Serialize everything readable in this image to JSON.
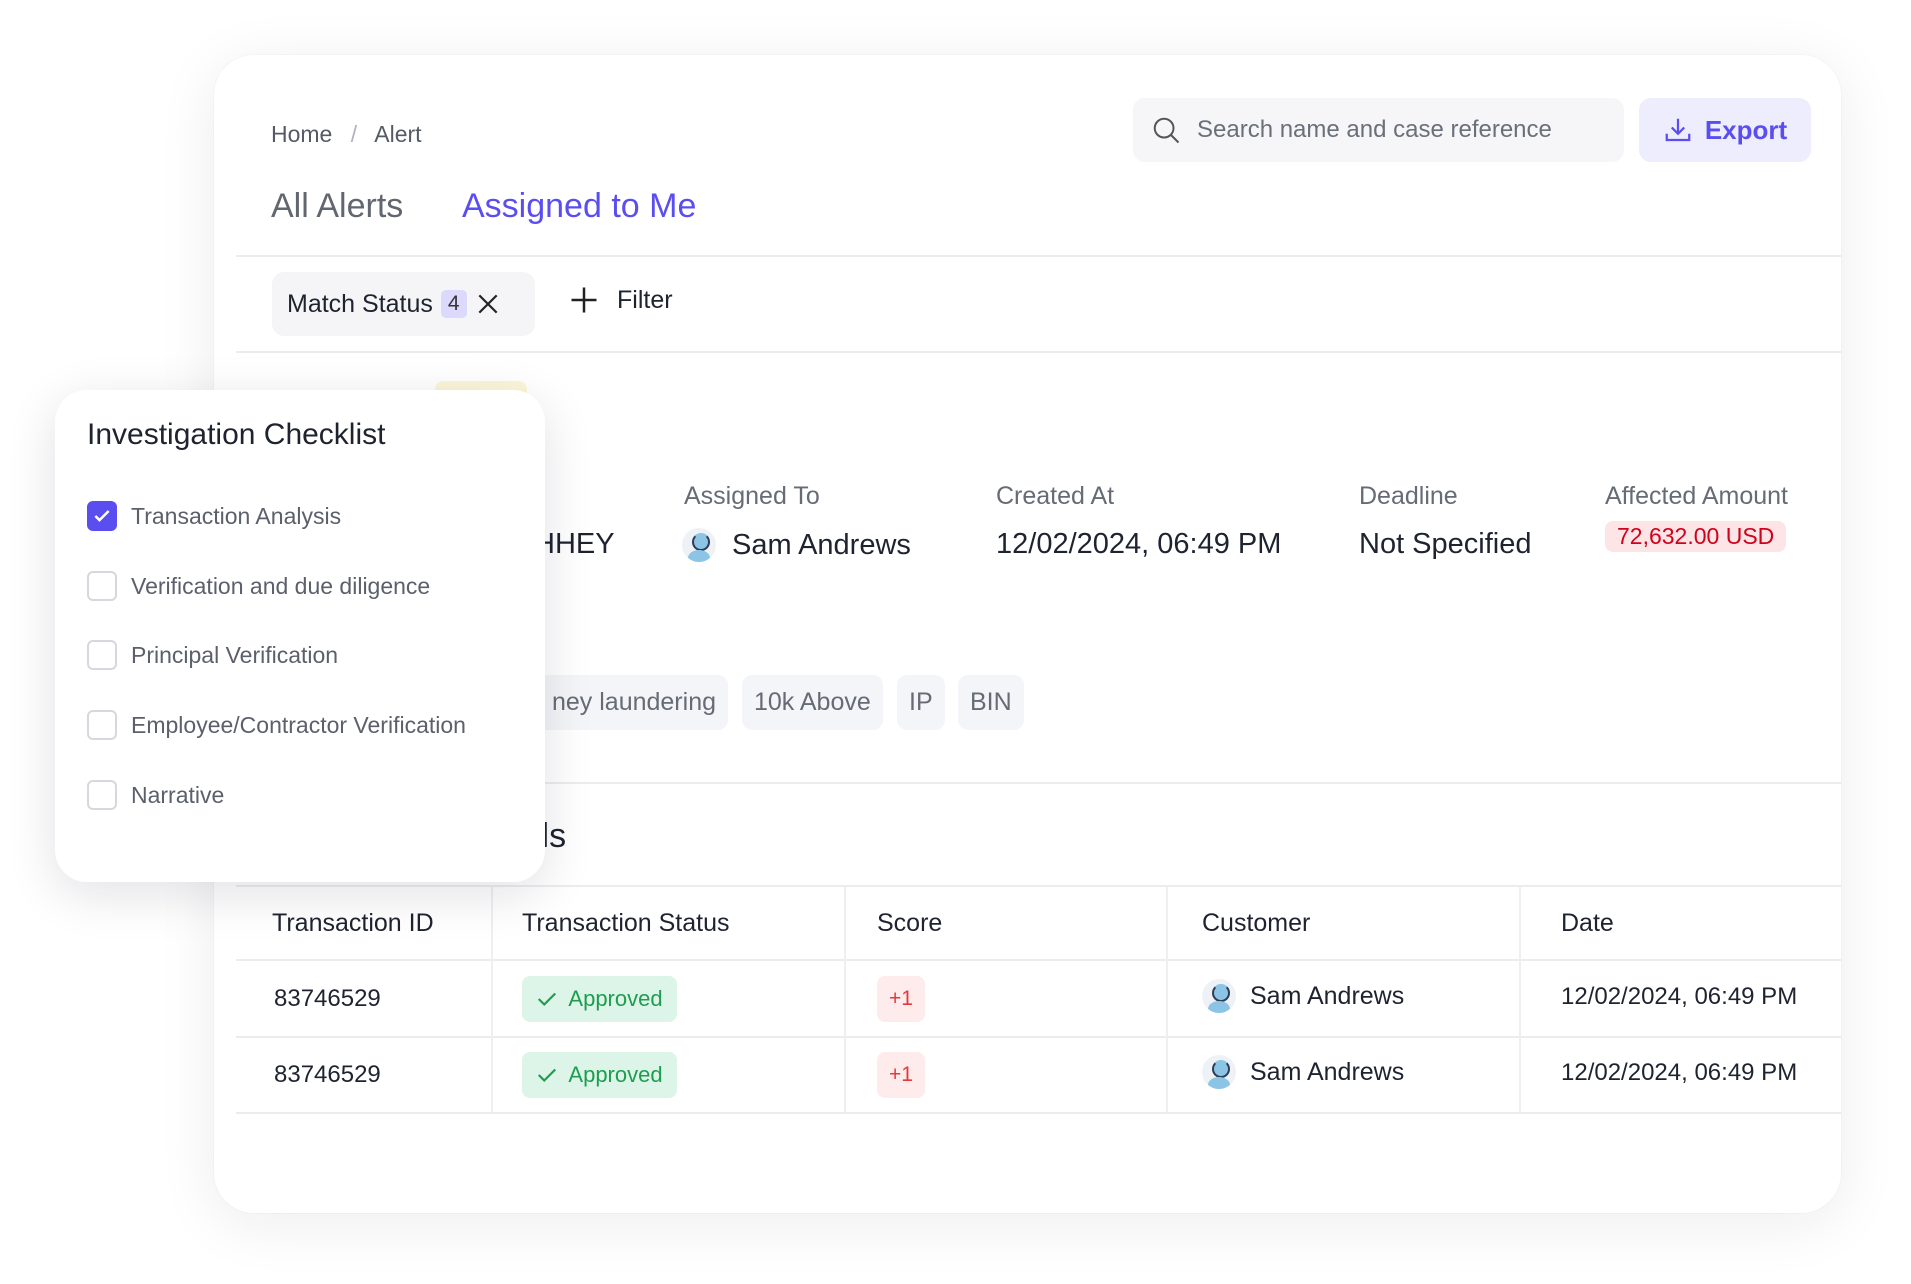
{
  "breadcrumb": {
    "items": [
      "Home",
      "Alert"
    ],
    "separator": "/"
  },
  "search": {
    "placeholder": "Search name and case reference",
    "icon": "search-icon"
  },
  "export": {
    "label": "Export",
    "icon": "download-icon"
  },
  "tabs": [
    {
      "label": "All Alerts",
      "active": false
    },
    {
      "label": "Assigned to Me",
      "active": true
    }
  ],
  "filters": {
    "chip_label": "Match Status",
    "chip_count": "4",
    "add_label": "Filter"
  },
  "alert": {
    "name_fragment": "HHEY",
    "assigned_to": {
      "label": "Assigned To",
      "value": "Sam Andrews"
    },
    "created_at": {
      "label": "Created At",
      "value": "12/02/2024, 06:49 PM"
    },
    "deadline": {
      "label": "Deadline",
      "value": "Not Specified"
    },
    "affected_amount": {
      "label": "Affected Amount",
      "value": "72,632.00 USD"
    },
    "tags": [
      "ney laundering",
      "10k Above",
      "IP",
      "BIN"
    ]
  },
  "section_heading_fragment": "ils",
  "table": {
    "columns": [
      "Transaction ID",
      "Transaction Status",
      "Score",
      "Customer",
      "Date"
    ],
    "rows": [
      {
        "id": "83746529",
        "status": "Approved",
        "score": "+1",
        "customer": "Sam Andrews",
        "date": "12/02/2024, 06:49 PM"
      },
      {
        "id": "83746529",
        "status": "Approved",
        "score": "+1",
        "customer": "Sam Andrews",
        "date": "12/02/2024, 06:49 PM"
      }
    ]
  },
  "checklist": {
    "title": "Investigation Checklist",
    "items": [
      {
        "label": "Transaction Analysis",
        "checked": true
      },
      {
        "label": "Verification and due diligence",
        "checked": false
      },
      {
        "label": "Principal Verification",
        "checked": false
      },
      {
        "label": "Employee/Contractor Verification",
        "checked": false
      },
      {
        "label": "Narrative",
        "checked": false
      }
    ]
  },
  "colors": {
    "accent": "#5b4ef0",
    "danger": "#d0021b",
    "success": "#1f9d4f"
  }
}
